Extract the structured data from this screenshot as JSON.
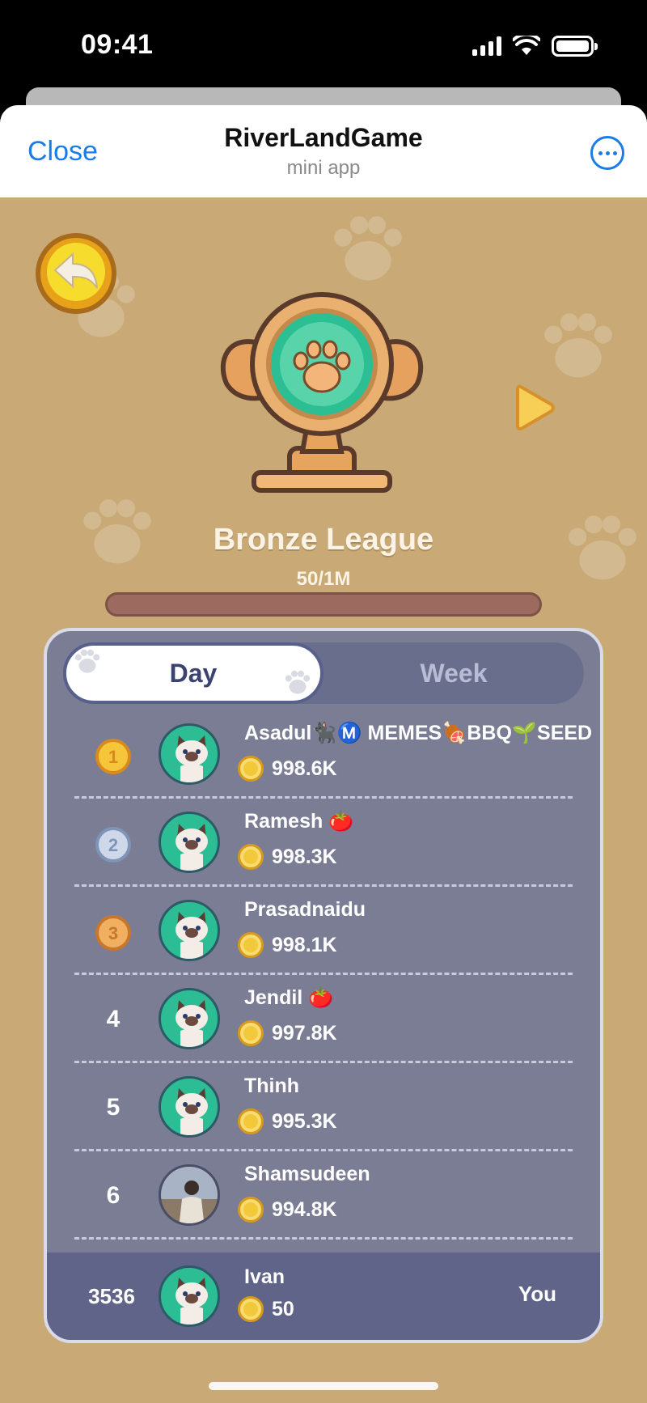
{
  "status_bar": {
    "time": "09:41"
  },
  "header": {
    "close_label": "Close",
    "title": "RiverLandGame",
    "subtitle": "mini app"
  },
  "league": {
    "name": "Bronze League",
    "progress_text": "50/1M",
    "progress_fraction": 5e-05
  },
  "tabs": [
    {
      "label": "Day",
      "selected": true
    },
    {
      "label": "Week",
      "selected": false
    }
  ],
  "leaderboard": [
    {
      "rank": "1",
      "rank_style": "gold-medal-icon",
      "name": "Asadul🐈‍⬛Ⓜ️ MEMES🍖BBQ🌱SEED",
      "score": "998.6K",
      "avatar": "cat-avatar"
    },
    {
      "rank": "2",
      "rank_style": "silver-medal-icon",
      "name": "Ramesh 🍅",
      "score": "998.3K",
      "avatar": "cat-avatar"
    },
    {
      "rank": "3",
      "rank_style": "bronze-medal-icon",
      "name": "Prasadnaidu",
      "score": "998.1K",
      "avatar": "cat-avatar"
    },
    {
      "rank": "4",
      "rank_style": "text",
      "name": "Jendil 🍅",
      "score": "997.8K",
      "avatar": "cat-avatar"
    },
    {
      "rank": "5",
      "rank_style": "text",
      "name": "Thinh",
      "score": "995.3K",
      "avatar": "cat-avatar"
    },
    {
      "rank": "6",
      "rank_style": "text",
      "name": "Shamsudeen",
      "score": "994.8K",
      "avatar": "photo-avatar"
    }
  ],
  "current_user": {
    "rank": "3536",
    "name": "Ivan",
    "score": "50",
    "you_label": "You"
  },
  "colors": {
    "accent": "#1a7ce6",
    "background": "#c9aa76",
    "panel": "#7a7d94",
    "coin": "#f3c93c"
  }
}
